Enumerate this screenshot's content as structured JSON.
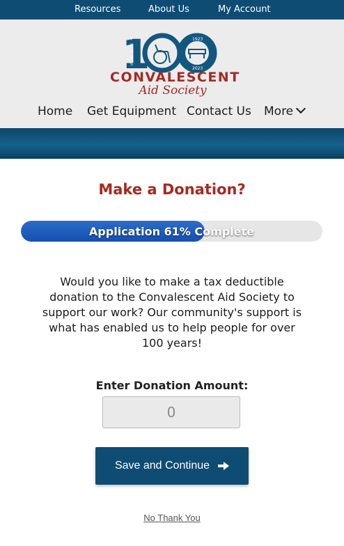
{
  "top_nav": {
    "resources": "Resources",
    "about": "About Us",
    "account": "My Account"
  },
  "brand": {
    "line1": "CONVALESCENT",
    "line2": "Aid Society",
    "badge_number": "100",
    "years_text": "YEARS",
    "year_start": "1923",
    "year_end": "2023",
    "color": "#a42a24"
  },
  "main_nav": {
    "home": "Home",
    "equipment": "Get Equipment",
    "contact": "Contact Us",
    "more": "More"
  },
  "page": {
    "title": "Make a Donation?",
    "progress_text": "Application 61% Complete",
    "progress_percent": 61,
    "paragraph": "Would you like to make a tax deductible donation to the Convalescent Aid Society to support our work?  Our community's support is what has enabled us to help people for over 100 years!",
    "amount_label": "Enter Donation Amount:",
    "amount_placeholder": "0",
    "save_button": "Save and Continue",
    "no_thanks": "No Thank You"
  },
  "colors": {
    "primary": "#0f4c73",
    "accent_red": "#a7291f",
    "progress_fill": "#1650b0"
  },
  "icons": {
    "save_arrow": "arrow-right-icon",
    "more_chevron": "chevron-down-icon",
    "wheelchair": "wheelchair-icon",
    "bed": "hospital-bed-icon"
  }
}
